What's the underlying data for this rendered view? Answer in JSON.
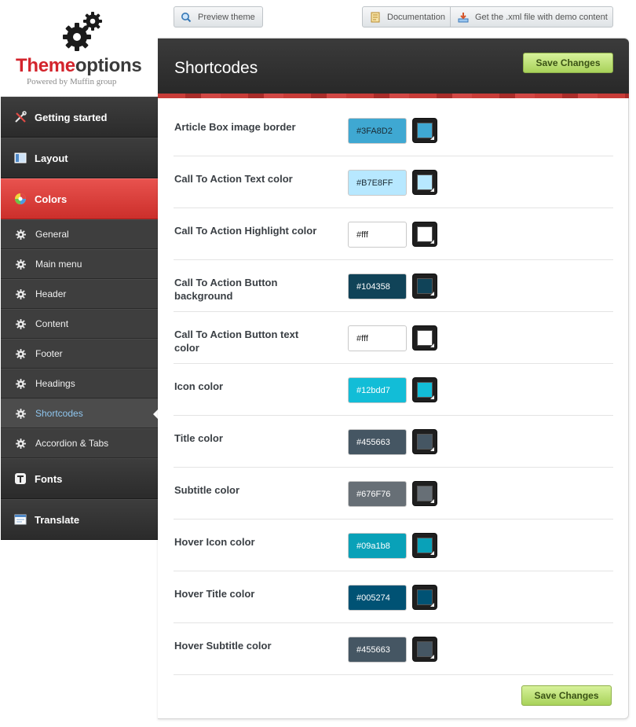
{
  "toolbar": {
    "preview_label": "Preview theme",
    "documentation_label": "Documentation",
    "demo_label": "Get the .xml file with demo content"
  },
  "logo": {
    "title_part1": "Theme",
    "title_part2": "options",
    "subtitle": "Powered by Muffin group"
  },
  "sidebar": {
    "main_items": [
      {
        "label": "Getting started",
        "icon": "tools-icon"
      },
      {
        "label": "Layout",
        "icon": "layout-icon"
      },
      {
        "label": "Colors",
        "icon": "color-wheel-icon",
        "active": true
      },
      {
        "label": "Fonts",
        "icon": "font-icon"
      },
      {
        "label": "Translate",
        "icon": "translate-icon"
      }
    ],
    "sub_items": [
      {
        "label": "General"
      },
      {
        "label": "Main menu"
      },
      {
        "label": "Header"
      },
      {
        "label": "Content"
      },
      {
        "label": "Footer"
      },
      {
        "label": "Headings"
      },
      {
        "label": "Shortcodes",
        "active": true
      },
      {
        "label": "Accordion & Tabs"
      }
    ]
  },
  "panel": {
    "title": "Shortcodes",
    "save_label": "Save Changes",
    "rows": [
      {
        "label": "Article Box image border",
        "value": "#3FA8D2",
        "color": "#3FA8D2",
        "text_color": "#1a2a33"
      },
      {
        "label": "Call To Action Text color",
        "value": "#B7E8FF",
        "color": "#B7E8FF",
        "text_color": "#1a2a33"
      },
      {
        "label": "Call To Action Highlight color",
        "value": "#fff",
        "color": "#ffffff",
        "text_color": "#222222"
      },
      {
        "label": "Call To Action Button background",
        "value": "#104358",
        "color": "#104358",
        "text_color": "#ffffff"
      },
      {
        "label": "Call To Action Button text color",
        "value": "#fff",
        "color": "#ffffff",
        "text_color": "#222222"
      },
      {
        "label": "Icon color",
        "value": "#12bdd7",
        "color": "#12bdd7",
        "text_color": "#ffffff"
      },
      {
        "label": "Title color",
        "value": "#455663",
        "color": "#455663",
        "text_color": "#ffffff"
      },
      {
        "label": "Subtitle color",
        "value": "#676F76",
        "color": "#676F76",
        "text_color": "#ffffff"
      },
      {
        "label": "Hover Icon color",
        "value": "#09a1b8",
        "color": "#09a1b8",
        "text_color": "#ffffff"
      },
      {
        "label": "Hover Title color",
        "value": "#005274",
        "color": "#005274",
        "text_color": "#ffffff"
      },
      {
        "label": "Hover Subtitle color",
        "value": "#455663",
        "color": "#455663",
        "text_color": "#ffffff"
      }
    ]
  },
  "colors": {
    "accent_red": "#d3242c",
    "save_green": "#a8d25a",
    "active_sub_text": "#8fc6ef"
  }
}
